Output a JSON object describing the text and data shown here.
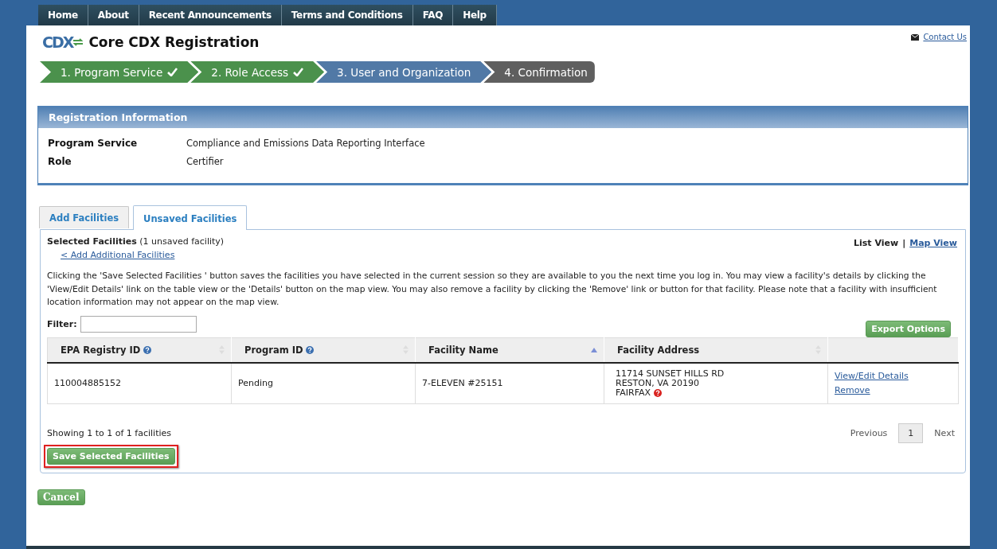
{
  "nav": [
    {
      "label": "Home"
    },
    {
      "label": "About"
    },
    {
      "label": "Recent Announcements"
    },
    {
      "label": "Terms and Conditions"
    },
    {
      "label": "FAQ"
    },
    {
      "label": "Help"
    }
  ],
  "header": {
    "logo": "CDX",
    "title": "Core CDX Registration",
    "contact_link": "Contact Us"
  },
  "steps": [
    {
      "label": "1. Program Service",
      "completed": true,
      "current": false
    },
    {
      "label": "2. Role Access",
      "completed": true,
      "current": false
    },
    {
      "label": "3. User and Organization",
      "completed": false,
      "current": true
    },
    {
      "label": "4. Confirmation",
      "completed": false,
      "current": false
    }
  ],
  "registration_info": {
    "title": "Registration Information",
    "fields": [
      {
        "label": "Program Service",
        "value": "Compliance and Emissions Data Reporting Interface"
      },
      {
        "label": "Role",
        "value": "Certifier"
      }
    ]
  },
  "tabs": [
    {
      "label": "Add Facilities",
      "selected": false
    },
    {
      "label": "Unsaved Facilities",
      "selected": true
    }
  ],
  "selected_facilities": {
    "title": "Selected Facilities",
    "count": "(1 unsaved facility)",
    "back_link": "< Add Additional Facilities",
    "views": [
      {
        "label": "List View",
        "selected": true
      },
      {
        "label": "Map View",
        "selected": false
      }
    ],
    "view_separator": "|",
    "instructions": "Clicking the 'Save Selected Facilities ' button saves the facilities you have selected in the current session so they are available to you the next time you log in. You may view a facility's details by clicking the 'View/Edit Details' link on the table view or the 'Details' button on the map view. You may also remove a facility by clicking the 'Remove' link or button for that facility. Please note that a facility with insufficient location information may not appear on the map view.",
    "filter_label": "Filter:",
    "export_button": "Export Options",
    "table": {
      "columns": [
        {
          "label": "EPA Registry ID",
          "help": true,
          "sorted": false
        },
        {
          "label": "Program ID",
          "help": true,
          "sorted": false
        },
        {
          "label": "Facility Name",
          "help": false,
          "sorted": true
        },
        {
          "label": "Facility Address",
          "help": false,
          "sorted": false
        }
      ],
      "rows": [
        {
          "epa_registry_id": "110004885152",
          "program_id": "Pending",
          "facility_name": "7-ELEVEN #25151",
          "address_lines": [
            "11714 SUNSET HILLS RD",
            "RESTON, VA 20190",
            "FAIRFAX"
          ],
          "address_warning": true,
          "actions": [
            "View/Edit Details",
            "Remove"
          ]
        }
      ]
    },
    "summary": "Showing 1 to 1 of 1 facilities",
    "pagination": {
      "previous": "Previous",
      "pages": [
        {
          "label": "1",
          "selected": true
        }
      ],
      "next": "Next"
    },
    "save_button": {
      "label": "Save Selected Facilities",
      "highlighted": true
    }
  },
  "cancel_button": "Cancel"
}
